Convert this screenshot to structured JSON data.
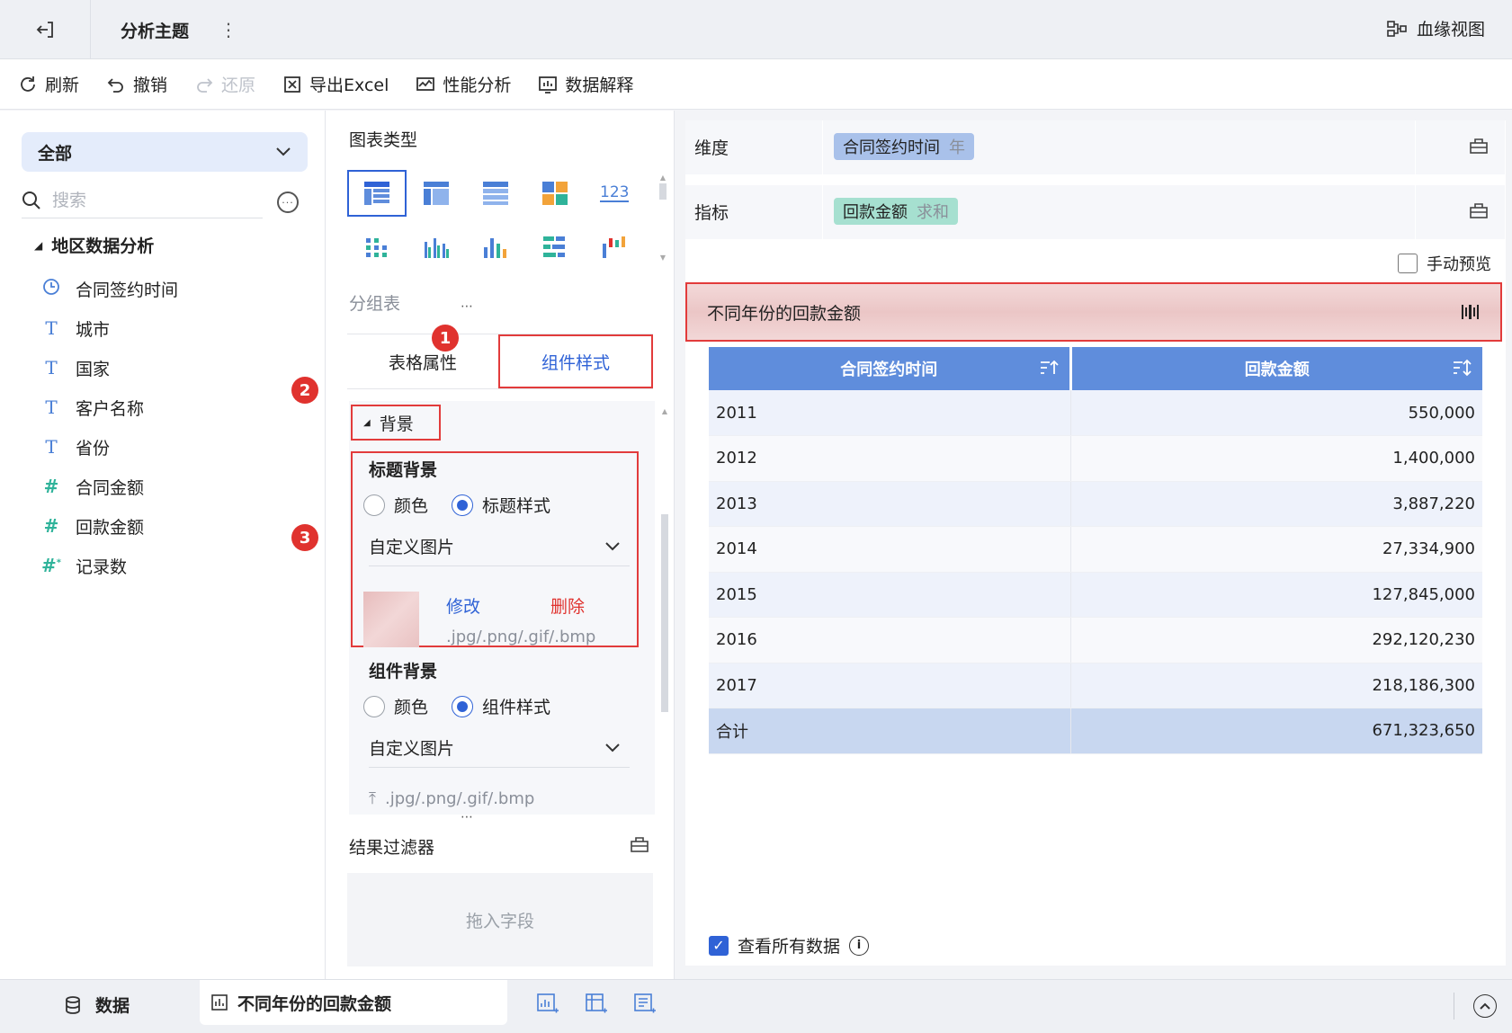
{
  "header": {
    "title": "分析主题",
    "lineage_label": "血缘视图"
  },
  "toolbar": {
    "refresh": "刷新",
    "undo": "撤销",
    "redo": "还原",
    "export": "导出Excel",
    "perf": "性能分析",
    "explain": "数据解释"
  },
  "fields": {
    "scope": "全部",
    "search_placeholder": "搜索",
    "folder": "地区数据分析",
    "items": [
      {
        "label": "合同签约时间",
        "icon": "clock-icon"
      },
      {
        "label": "城市",
        "icon": "text-type-icon"
      },
      {
        "label": "国家",
        "icon": "text-type-icon"
      },
      {
        "label": "客户名称",
        "icon": "text-type-icon"
      },
      {
        "label": "省份",
        "icon": "text-type-icon"
      },
      {
        "label": "合同金额",
        "icon": "number-type-icon"
      },
      {
        "label": "回款金额",
        "icon": "number-type-icon"
      },
      {
        "label": "记录数",
        "icon": "count-type-icon"
      }
    ]
  },
  "config": {
    "chart_type_label": "图表类型",
    "chart_type_name": "分组表",
    "tabs": [
      "表格属性",
      "组件样式"
    ],
    "badges": [
      "1",
      "2",
      "3"
    ],
    "background_section": "背景",
    "title_bg": {
      "label": "标题背景",
      "option_color": "颜色",
      "option_style": "标题样式",
      "select_value": "自定义图片",
      "edit": "修改",
      "delete": "删除",
      "formats": ".jpg/.png/.gif/.bmp"
    },
    "component_bg": {
      "label": "组件背景",
      "option_color": "颜色",
      "option_style": "组件样式",
      "select_value": "自定义图片",
      "formats": ".jpg/.png/.gif/.bmp"
    },
    "result_filter": "结果过滤器",
    "drop_hint": "拖入字段"
  },
  "preview": {
    "dimension_label": "维度",
    "dimension_field": "合同签约时间",
    "dimension_agg": "年",
    "measure_label": "指标",
    "measure_field": "回款金额",
    "measure_agg": "求和",
    "manual_preview": "手动预览",
    "component_title": "不同年份的回款金额",
    "view_all": "查看所有数据",
    "table": {
      "headers": [
        "合同签约时间",
        "回款金额"
      ],
      "rows": [
        [
          "2011",
          "550,000"
        ],
        [
          "2012",
          "1,400,000"
        ],
        [
          "2013",
          "3,887,220"
        ],
        [
          "2014",
          "27,334,900"
        ],
        [
          "2015",
          "127,845,000"
        ],
        [
          "2016",
          "292,120,230"
        ],
        [
          "2017",
          "218,186,300"
        ]
      ],
      "total": [
        "合计",
        "671,323,650"
      ]
    }
  },
  "bottom": {
    "data_tab": "数据",
    "component_tab": "不同年份的回款金额"
  },
  "colors": {
    "accent": "#2f62d6",
    "highlight": "#e23b3b",
    "header_blue": "#5f8ddc",
    "measure_pill": "#a6e0d0",
    "dimension_pill": "#a9c1ea"
  }
}
